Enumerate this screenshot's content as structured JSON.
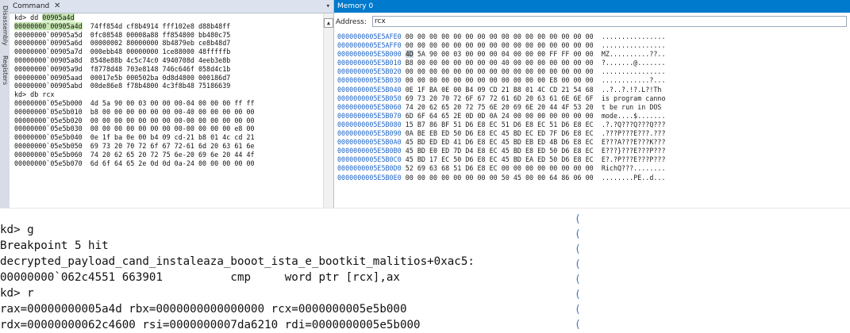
{
  "side_tabs": [
    "Disassembly",
    "Registers"
  ],
  "command_window": {
    "tab_label": "Command",
    "close_glyph": "✕",
    "menu_glyph": "▾",
    "scroll_up_glyph": "▲",
    "lines": [
      {
        "pre": "kd> dd ",
        "hl": "00905a4d",
        "post": ""
      },
      {
        "pre": "",
        "hl": "00000000`00905a4d",
        "post": "  74ff854d cf8b4914 fff102e8 d88b48ff"
      },
      {
        "pre": "00000000`00905a5d  0fc08548 00008a88 ff854800 bb480c75",
        "hl": "",
        "post": ""
      },
      {
        "pre": "00000000`00905a6d  00000002 80000000 8b4879eb ce8b48d7",
        "hl": "",
        "post": ""
      },
      {
        "pre": "00000000`00905a7d  000ebb48 00000000 1ce88000 48fffffb",
        "hl": "",
        "post": ""
      },
      {
        "pre": "00000000`00905a8d  8548e88b 4c5c74c0 4940708d 4eeb3e8b",
        "hl": "",
        "post": ""
      },
      {
        "pre": "00000000`00905a9d  f8778d48 703e8148 746c646f 058d4c1b",
        "hl": "",
        "post": ""
      },
      {
        "pre": "00000000`00905aad  00017e5b 000502ba 0d8d4800 000186d7",
        "hl": "",
        "post": ""
      },
      {
        "pre": "00000000`00905abd  00de86e8 f78b4800 4c3f8b48 75186639",
        "hl": "",
        "post": ""
      },
      {
        "pre": "kd> db rcx",
        "hl": "",
        "post": ""
      },
      {
        "pre": "00000000`05e5b000  4d 5a 90 00 03 00 00 00-04 00 00 00 ff ff",
        "hl": "",
        "post": ""
      },
      {
        "pre": "00000000`05e5b010  b8 00 00 00 00 00 00 00-40 00 00 00 00 00",
        "hl": "",
        "post": ""
      },
      {
        "pre": "00000000`05e5b020  00 00 00 00 00 00 00 00-00 00 00 00 00 00",
        "hl": "",
        "post": ""
      },
      {
        "pre": "00000000`05e5b030  00 00 00 00 00 00 00 00-00 00 00 00 e8 00",
        "hl": "",
        "post": ""
      },
      {
        "pre": "00000000`05e5b040  0e 1f ba 0e 00 b4 09 cd-21 b8 01 4c cd 21",
        "hl": "",
        "post": ""
      },
      {
        "pre": "00000000`05e5b050  69 73 20 70 72 6f 67 72-61 6d 20 63 61 6e",
        "hl": "",
        "post": ""
      },
      {
        "pre": "00000000`05e5b060  74 20 62 65 20 72 75 6e-20 69 6e 20 44 4f",
        "hl": "",
        "post": ""
      },
      {
        "pre": "00000000`05e5b070  6d 6f 64 65 2e 0d 0d 0a-24 00 00 00 00 00",
        "hl": "",
        "post": ""
      }
    ]
  },
  "memory_window": {
    "title": "Memory 0",
    "address_label": "Address:",
    "address_value": "rcx",
    "rows": [
      {
        "addr": "0000000005E5AFE0",
        "hex": "00 00 00 00 00 00 00 00 00 00 00 00 00 00 00 00",
        "ascii": "................"
      },
      {
        "addr": "0000000005E5AFF0",
        "hex": "00 00 00 00 00 00 00 00 00 00 00 00 00 00 00 00",
        "ascii": "................"
      },
      {
        "addr": "0000000005E5B000",
        "sel": "4D",
        "hex": " 5A 90 00 03 00 00 00 04 00 00 00 FF FF 00 00",
        "ascii": "MZ..........??.."
      },
      {
        "addr": "0000000005E5B010",
        "hex": "B8 00 00 00 00 00 00 00 40 00 00 00 00 00 00 00",
        "ascii": "?.......@......."
      },
      {
        "addr": "0000000005E5B020",
        "hex": "00 00 00 00 00 00 00 00 00 00 00 00 00 00 00 00",
        "ascii": "................"
      },
      {
        "addr": "0000000005E5B030",
        "hex": "00 00 00 00 00 00 00 00 00 00 00 00 E8 00 00 00",
        "ascii": "............?..."
      },
      {
        "addr": "0000000005E5B040",
        "hex": "0E 1F BA 0E 00 B4 09 CD 21 B8 01 4C CD 21 54 68",
        "ascii": "..?..?.!?.L?!Th"
      },
      {
        "addr": "0000000005E5B050",
        "hex": "69 73 20 70 72 6F 67 72 61 6D 20 63 61 6E 6E 6F",
        "ascii": "is program canno"
      },
      {
        "addr": "0000000005E5B060",
        "hex": "74 20 62 65 20 72 75 6E 20 69 6E 20 44 4F 53 20",
        "ascii": "t be run in DOS "
      },
      {
        "addr": "0000000005E5B070",
        "hex": "6D 6F 64 65 2E 0D 0D 0A 24 00 00 00 00 00 00 00",
        "ascii": "mode....$......."
      },
      {
        "addr": "0000000005E5B080",
        "hex": "15 B7 86 BF 51 D6 E8 EC 51 D6 E8 EC 51 D6 E8 EC",
        "ascii": ".?.?Q???Q???Q???"
      },
      {
        "addr": "0000000005E5B090",
        "hex": "0A BE EB ED 50 D6 E8 EC 45 BD EC ED 7F D6 E8 EC",
        "ascii": ".???P???E???.???"
      },
      {
        "addr": "0000000005E5B0A0",
        "hex": "45 BD ED ED 41 D6 E8 EC 45 BD EB ED 4B D6 E8 EC",
        "ascii": "E???A???E???K???"
      },
      {
        "addr": "0000000005E5B0B0",
        "hex": "45 BD E0 ED 7D D4 E8 EC 45 BD E8 ED 50 D6 E8 EC",
        "ascii": "E???}???E???P???"
      },
      {
        "addr": "0000000005E5B0C0",
        "hex": "45 BD 17 EC 50 D6 E8 EC 45 BD EA ED 50 D6 E8 EC",
        "ascii": "E?.?P???E???P???"
      },
      {
        "addr": "0000000005E5B0D0",
        "hex": "52 69 63 68 51 D6 E8 EC 00 00 00 00 00 00 00 00",
        "ascii": "RichQ???........"
      },
      {
        "addr": "0000000005E5B0E0",
        "hex": "00 00 00 00 00 00 00 00 50 45 00 00 64 86 06 00",
        "ascii": "........PE..d..."
      }
    ]
  },
  "console": {
    "lines": [
      "kd> g",
      "Breakpoint 5 hit",
      "decrypted_payload_cand_instaleaza_booot_ista_e_bootkit_malitios+0xac5:",
      "00000000`062c4551 663901          cmp     word ptr [rcx],ax",
      "kd> r",
      "rax=00000000005a4d rbx=0000000000000000 rcx=0000000005e5b000",
      "rdx=00000000062c4600 rsi=0000000007da6210 rdi=0000000005e5b000"
    ]
  },
  "gutter_glyph": "("
}
